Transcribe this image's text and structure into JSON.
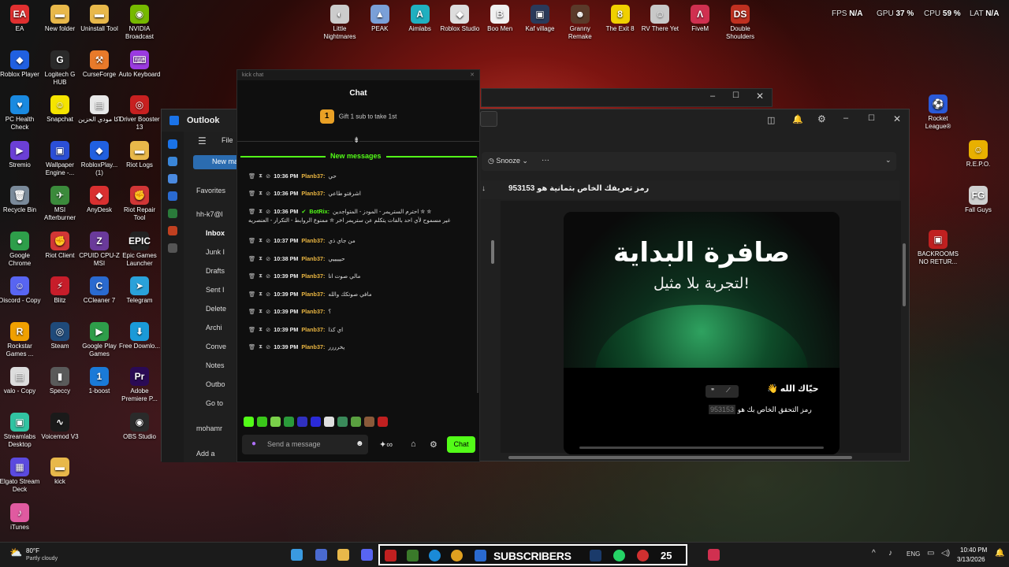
{
  "desktop_left": [
    {
      "label": "EA",
      "color": "#e03030",
      "glyph": "EA"
    },
    {
      "label": "Roblox Player",
      "color": "#2060e0",
      "glyph": "◆"
    },
    {
      "label": "PC Health Check",
      "color": "#1a8ae0",
      "glyph": "♥"
    },
    {
      "label": "Stremio",
      "color": "#6b3fd6",
      "glyph": "▶"
    },
    {
      "label": "Recycle Bin",
      "color": "#7a8a9a",
      "glyph": "🗑"
    },
    {
      "label": "Google Chrome",
      "color": "#2e9e4a",
      "glyph": "●"
    },
    {
      "label": "Discord - Copy",
      "color": "#5865f2",
      "glyph": "☺"
    },
    {
      "label": "Rockstar Games ...",
      "color": "#f0a000",
      "glyph": "R"
    },
    {
      "label": "valo - Copy",
      "color": "#dddddd",
      "glyph": "▤"
    },
    {
      "label": "Streamlabs Desktop",
      "color": "#31c3a2",
      "glyph": "▣"
    },
    {
      "label": "Elgato Stream Deck",
      "color": "#5b4adf",
      "glyph": "▦"
    },
    {
      "label": "iTunes",
      "color": "#e05aa0",
      "glyph": "♪"
    }
  ],
  "desktop_col2": [
    {
      "label": "New folder",
      "color": "#e8b84a",
      "glyph": "▬"
    },
    {
      "label": "Logitech G HUB",
      "color": "#2a2a2a",
      "glyph": "G"
    },
    {
      "label": "Snapchat",
      "color": "#f5e400",
      "glyph": "☺"
    },
    {
      "label": "Wallpaper Engine -...",
      "color": "#2b4fd6",
      "glyph": "▣"
    },
    {
      "label": "MSI Afterburner",
      "color": "#3b8a3b",
      "glyph": "✈"
    },
    {
      "label": "Riot Client",
      "color": "#d13636",
      "glyph": "✊"
    },
    {
      "label": "Blitz",
      "color": "#c71d2a",
      "glyph": "⚡"
    },
    {
      "label": "Steam",
      "color": "#1f4a7a",
      "glyph": "◎"
    },
    {
      "label": "Speccy",
      "color": "#5a5a5a",
      "glyph": "▮"
    },
    {
      "label": "Voicemod V3",
      "color": "#1a1a1a",
      "glyph": "∿"
    },
    {
      "label": "kick",
      "color": "#e8b84a",
      "glyph": "▬"
    }
  ],
  "desktop_col3": [
    {
      "label": "Uninstall Tool",
      "color": "#e8b84a",
      "glyph": "▬"
    },
    {
      "label": "CurseForge",
      "color": "#e87a2a",
      "glyph": "⚒"
    },
    {
      "label": "اكا مودي الحزين",
      "color": "#e8e8e8",
      "glyph": "▤"
    },
    {
      "label": "RobloxPlay... (1)",
      "color": "#2060e0",
      "glyph": "◆"
    },
    {
      "label": "AnyDesk",
      "color": "#d93030",
      "glyph": "◆"
    },
    {
      "label": "CPUID CPU-Z MSI",
      "color": "#6a3a9a",
      "glyph": "Z"
    },
    {
      "label": "CCleaner 7",
      "color": "#2a6ad0",
      "glyph": "C"
    },
    {
      "label": "Google Play Games",
      "color": "#2e9e4a",
      "glyph": "▶"
    },
    {
      "label": "1-boost",
      "color": "#1a7ad8",
      "glyph": "1"
    }
  ],
  "desktop_col4": [
    {
      "label": "NVIDIA Broadcast",
      "color": "#76b900",
      "glyph": "◉"
    },
    {
      "label": "Auto Keyboard",
      "color": "#9a3ae0",
      "glyph": "⌨"
    },
    {
      "label": "Driver Booster 13",
      "color": "#c82020",
      "glyph": "◎"
    },
    {
      "label": "Riot Logs",
      "color": "#e8b84a",
      "glyph": "▬"
    },
    {
      "label": "Riot Repair Tool",
      "color": "#d13636",
      "glyph": "✊"
    },
    {
      "label": "Epic Games Launcher",
      "color": "#222222",
      "glyph": "EPIC"
    },
    {
      "label": "Telegram",
      "color": "#2aa1da",
      "glyph": "➤"
    },
    {
      "label": "Free Downlo...",
      "color": "#1a9ad8",
      "glyph": "⬇"
    },
    {
      "label": "Adobe Premiere P...",
      "color": "#2a0a55",
      "glyph": "Pr"
    },
    {
      "label": "OBS Studio",
      "color": "#2a2a2a",
      "glyph": "◉"
    }
  ],
  "desktop_top": [
    {
      "label": "Little Nightmares",
      "color": "#cccccc",
      "glyph": "◐"
    },
    {
      "label": "PEAK",
      "color": "#7aa0d8",
      "glyph": "▲"
    },
    {
      "label": "Aimlabs",
      "color": "#20b0c0",
      "glyph": "A"
    },
    {
      "label": "Roblox Studio",
      "color": "#dddddd",
      "glyph": "◆"
    },
    {
      "label": "Boo Men",
      "color": "#f0f0f0",
      "glyph": "B"
    },
    {
      "label": "Kaf village",
      "color": "#2a3a5a",
      "glyph": "▣"
    },
    {
      "label": "Granny Remake",
      "color": "#5a3a2a",
      "glyph": "☻"
    },
    {
      "label": "The Exit 8",
      "color": "#f0d000",
      "glyph": "8"
    },
    {
      "label": "RV There Yet",
      "color": "#c8c8c8",
      "glyph": "☺"
    },
    {
      "label": "FiveM",
      "color": "#d03050",
      "glyph": "Λ"
    },
    {
      "label": "Double Shoulders",
      "color": "#c03020",
      "glyph": "DS"
    }
  ],
  "desktop_right": [
    {
      "label": "Rocket League®",
      "color": "#2a5ad8",
      "glyph": "⚽"
    },
    {
      "label": "R.E.P.O.",
      "color": "#e8b000",
      "glyph": "☺"
    },
    {
      "label": "Fall Guys",
      "color": "#d0d0d0",
      "glyph": "FG"
    },
    {
      "label": "BACKROOMS NO RETUR...",
      "color": "#c02020",
      "glyph": "▣"
    }
  ],
  "perf": {
    "fps_label": "FPS",
    "fps": "N/A",
    "gpu_label": "GPU",
    "gpu": "37 %",
    "cpu_label": "CPU",
    "cpu": "59 %",
    "lat_label": "LAT",
    "lat": "N/A"
  },
  "outlook": {
    "title": "Outlook",
    "file_menu": "File",
    "new_mail": "New ma",
    "snooze": "Snooze",
    "more": "···",
    "subject": "رمز تعريفك الخاص بثمانية هو 953153",
    "nav": [
      "Favorites",
      "hh-k7@l",
      "Inbox",
      "Junk I",
      "Drafts",
      "Sent I",
      "Delete",
      "Archi",
      "Conve",
      "Notes",
      "Outbo",
      "Go to",
      "mohamr",
      "Add a"
    ],
    "email_headline": "صافرة البداية",
    "email_sub": "لتجربة بلا مثيل!",
    "email_greeting": "حيّاك الله",
    "email_code_line": "رمز التحقق الخاص بك هو",
    "email_code": "953153"
  },
  "chat": {
    "window_title": "kick chat",
    "header": "Chat",
    "gift": "Gift 1 sub to take 1st",
    "gift_rank": "1",
    "new_messages": "New messages",
    "input_placeholder": "Send a message",
    "send_button": "Chat",
    "messages": [
      {
        "time": "10:36 PM",
        "user": "Planb37:",
        "text": "حي"
      },
      {
        "time": "10:36 PM",
        "user": "Planb37:",
        "text": "اشرفتو طاعي"
      },
      {
        "time": "10:36 PM",
        "user": "BotRix:",
        "text": "احترم الستريمر - المودز - المتواجدين ✮ ✮",
        "text2": "غير مسموح لأي احد بالفات يتكلم عن ستريمر اخر ✮ ممنوع الروابط - التكرار - العنصريه"
      },
      {
        "time": "10:37 PM",
        "user": "Planb37:",
        "text": "من جاي ذي"
      },
      {
        "time": "10:38 PM",
        "user": "Planb37:",
        "text": "حيييييي"
      },
      {
        "time": "10:39 PM",
        "user": "Planb37:",
        "text": "مالي صوت انا"
      },
      {
        "time": "10:39 PM",
        "user": "Planb37:",
        "text": "مافي صوتكك والله"
      },
      {
        "time": "10:39 PM",
        "user": "Planb37:",
        "text": "؟"
      },
      {
        "time": "10:39 PM",
        "user": "Planb37:",
        "text": "اي كذا"
      },
      {
        "time": "10:39 PM",
        "user": "Planb37:",
        "text": "يخرررر"
      }
    ]
  },
  "taskbar": {
    "weather_temp": "80°F",
    "weather_desc": "Partly cloudy",
    "subscribers": "SUBSCRIBERS",
    "sub_count": "25",
    "lang": "ENG",
    "time": "10:40 PM",
    "date": "3/13/2026"
  }
}
